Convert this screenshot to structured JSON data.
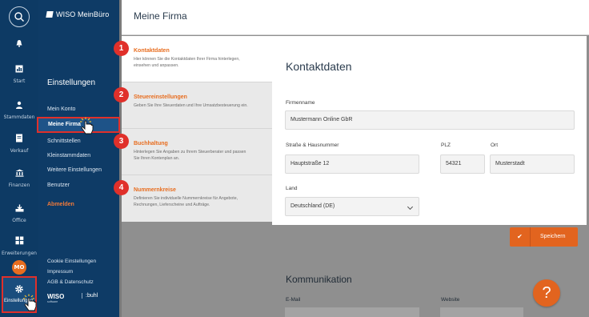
{
  "rail": {
    "items": [
      {
        "label": "",
        "icon": "bell-icon"
      },
      {
        "label": "Start",
        "icon": "chart-icon"
      },
      {
        "label": "Stammdaten",
        "icon": "person-icon"
      },
      {
        "label": "Verkauf",
        "icon": "document-icon"
      },
      {
        "label": "Finanzen",
        "icon": "bank-icon"
      },
      {
        "label": "Office",
        "icon": "download-icon"
      },
      {
        "label": "Erweiterungen",
        "icon": "grid-icon"
      }
    ],
    "avatar": "MO",
    "settings_label": "Einstellungen"
  },
  "sidebar": {
    "logo": "WISO MeinBüro",
    "title": "Einstellungen",
    "items": [
      "Mein Konto",
      "Meine Firma",
      "Schnittstellen",
      "Kleinstammdaten",
      "Weitere Einstellungen",
      "Benutzer"
    ],
    "logout": "Abmelden",
    "footer": [
      "Cookie Einstellungen",
      "Impressum",
      "AGB & Datenschutz"
    ],
    "brand": "WISO",
    "brand_sub": "software",
    "buhl": ":buhl"
  },
  "header": {
    "title": "Meine Firma"
  },
  "steps": [
    {
      "num": "1",
      "title": "Kontaktdaten",
      "desc": "Hier können Sie die Kontaktdaten Ihrer Firma hinterlegen, einsehen und anpassen."
    },
    {
      "num": "2",
      "title": "Steuereinstellungen",
      "desc": "Geben Sie Ihre Steuerdaten und Ihre Umsatzbesteuerung ein."
    },
    {
      "num": "3",
      "title": "Buchhaltung",
      "desc": "Hinterlegen Sie Angaben zu Ihrem Steuerberater und passen Sie Ihren Kontenplan an."
    },
    {
      "num": "4",
      "title": "Nummernkreise",
      "desc": "Definieren Sie individuelle Nummernkreise für Angebote, Rechnungen, Lieferscheine und Aufträge."
    }
  ],
  "form": {
    "title": "Kontaktdaten",
    "company_label": "Firmenname",
    "company_value": "Mustermann Online GbR",
    "street_label": "Straße & Hausnummer",
    "street_value": "Hauptstraße 12",
    "zip_label": "PLZ",
    "zip_value": "54321",
    "city_label": "Ort",
    "city_value": "Musterstadt",
    "country_label": "Land",
    "country_value": "Deutschland (DE)"
  },
  "save_label": "Speichern",
  "communication": {
    "title": "Kommunikation",
    "email_label": "E-Mail",
    "website_label": "Website"
  },
  "help": "?",
  "colors": {
    "accent": "#e2641f",
    "highlight": "#e0302a",
    "nav": "#0e3b66"
  }
}
